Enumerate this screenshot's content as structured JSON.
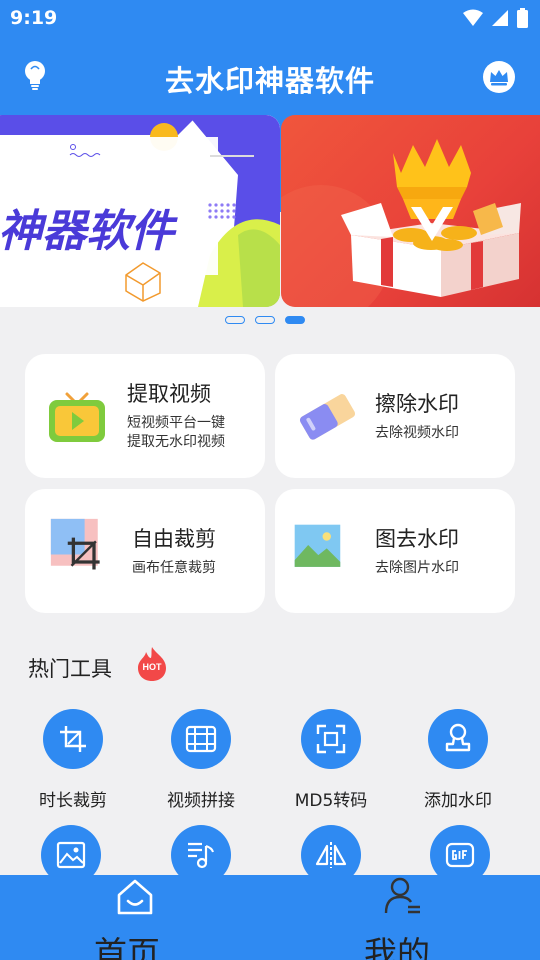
{
  "status_bar": {
    "time": "9:19"
  },
  "header": {
    "title": "去水印神器软件",
    "left_icon": "lightbulb-icon",
    "right_icon": "crown-icon"
  },
  "banner": {
    "slide1_text": "神器软件",
    "pages": 3,
    "active_page": 3
  },
  "features": [
    {
      "title": "提取视频",
      "desc_line1": "短视频平台一键",
      "desc_line2": "提取无水印视频",
      "icon": "tv-icon"
    },
    {
      "title": "擦除水印",
      "desc_line1": "去除视频水印",
      "icon": "eraser-icon"
    },
    {
      "title": "自由裁剪",
      "desc_line1": "画布任意裁剪",
      "icon": "crop-icon"
    },
    {
      "title": "图去水印",
      "desc_line1": "去除图片水印",
      "icon": "picture-icon"
    }
  ],
  "hot_tools": {
    "title": "热门工具",
    "badge": "HOT",
    "items": [
      {
        "label": "时长裁剪",
        "icon": "crop-icon"
      },
      {
        "label": "视频拼接",
        "icon": "film-icon"
      },
      {
        "label": "MD5转码",
        "icon": "scan-icon"
      },
      {
        "label": "添加水印",
        "icon": "stamp-icon"
      },
      {
        "label": "",
        "icon": "image-icon"
      },
      {
        "label": "",
        "icon": "music-list-icon"
      },
      {
        "label": "",
        "icon": "mirror-icon"
      },
      {
        "label": "",
        "icon": "gif-icon"
      }
    ]
  },
  "bottom_nav": {
    "home_label": "首页",
    "mine_label": "我的"
  },
  "colors": {
    "primary": "#2f8af2",
    "background": "#f0f0f2",
    "card": "#ffffff"
  }
}
